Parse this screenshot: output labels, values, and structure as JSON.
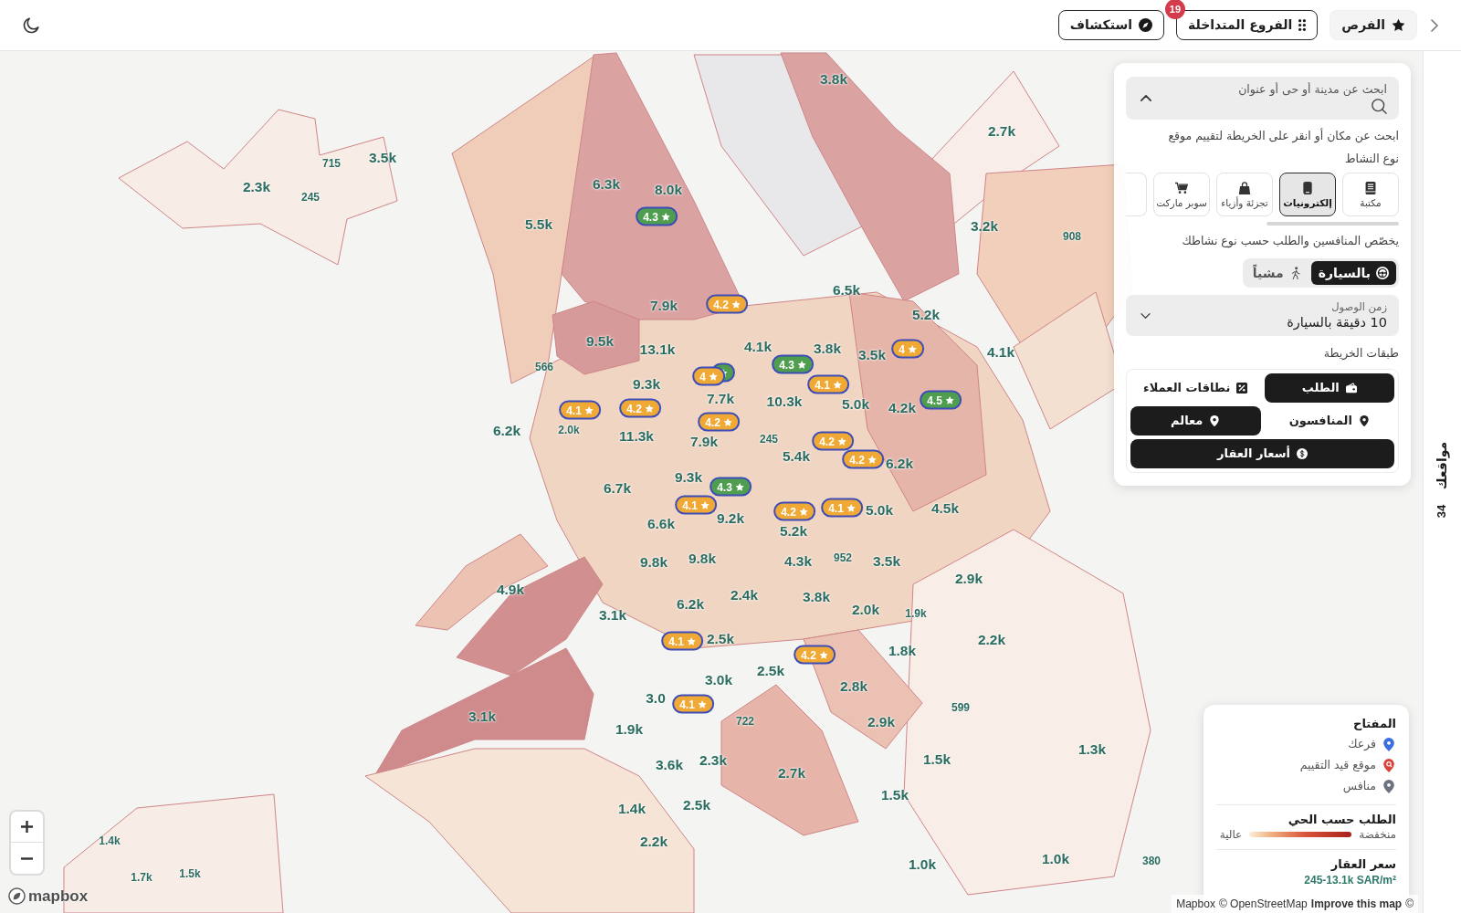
{
  "top_bar": {
    "buttons": [
      {
        "label": "الفرص",
        "kind": "filled"
      },
      {
        "label": "الفروع المتداخلة",
        "kind": "outlined",
        "badge": "19"
      },
      {
        "label": "استكشاف",
        "kind": "outlined"
      }
    ]
  },
  "side_panel": {
    "search": {
      "placeholder": "ابحث عن مدينة أو حى أو عنوان",
      "expanded": true
    },
    "hint": "ابحث عن مكان أو انقر على الخريطة لتقييم موقع",
    "activity_label": "نوع النشاط",
    "activity_types": [
      {
        "label": "مكتبة",
        "selected": false
      },
      {
        "label": "إلكترونيات",
        "selected": true
      },
      {
        "label": "تجزئة وأزياء",
        "selected": false
      },
      {
        "label": "سوبر ماركت",
        "selected": false
      },
      {
        "selected": false
      }
    ],
    "activity_note": "يخصّص المنافسين والطلب حسب نوع نشاطك",
    "travel_modes": [
      {
        "label": "بالسيارة",
        "selected": true
      },
      {
        "label": "مشياً",
        "selected": false
      }
    ],
    "arrival_time": {
      "label": "زمن الوصول",
      "value": "10 دقيقة بالسيارة"
    },
    "layers_label": "طبقات الخريطة",
    "layers": [
      {
        "label": "الطلب",
        "on": true
      },
      {
        "label": "نطاقات العملاء",
        "on": false
      },
      {
        "label": "المنافسون",
        "on": false
      },
      {
        "label": "معالم",
        "on": true
      },
      {
        "label": "أسعار العقار",
        "on": true
      }
    ]
  },
  "side_tab": {
    "label": "مواقعك",
    "count": "34"
  },
  "map": {
    "demand_labels": [
      "3.8k",
      "2.7k",
      "3.5k",
      "715",
      "2.3k",
      "245",
      "6.3k",
      "8.0k",
      "5.5k",
      "3.2k",
      "908",
      "6.5k",
      "5.2k",
      "7.9k",
      "9.5k",
      "13.1k",
      "4.1k",
      "3.8k",
      "3.5k",
      "4.1k",
      "566",
      "9.3k",
      "7.7k",
      "10.3k",
      "5.0k",
      "4.2k",
      "6.2k",
      "2.0k",
      "11.3k",
      "7.9k",
      "245",
      "5.4k",
      "6.2k",
      "9.3k",
      "6.7k",
      "9.2k",
      "6.6k",
      "5.2k",
      "5.0k",
      "4.5k",
      "9.8k",
      "9.8k",
      "4.3k",
      "952",
      "3.5k",
      "2.9k",
      "4.9k",
      "3.1k",
      "6.2k",
      "2.4k",
      "3.8k",
      "2.0k",
      "1.9k",
      "2.5k",
      "2.2k",
      "1.8k",
      "2.5k",
      "3.0k",
      "2.8k",
      "3.0",
      "3.1k",
      "722",
      "1.9k",
      "2.9k",
      "599",
      "3.6k",
      "2.3k",
      "2.7k",
      "1.5k",
      "1.3k",
      "1.5k",
      "1.4k",
      "2.5k",
      "2.2k",
      "1.0k",
      "1.0k",
      "380",
      "1.4k",
      "1.7k",
      "1.5k"
    ],
    "rating_markers": [
      {
        "rating": "4.3",
        "color": "#4f9d4f"
      },
      {
        "rating": "4.2",
        "color": "#f0a935"
      },
      {
        "rating": "4",
        "color": "#f0a935"
      },
      {
        "rating": "4.3",
        "color": "#4f9d4f"
      },
      {
        "color": "#4f9d4f"
      },
      {
        "rating": "4",
        "color": "#f0a935"
      },
      {
        "rating": "4.1",
        "color": "#f0a935"
      },
      {
        "rating": "4.5",
        "color": "#4f9d4f"
      },
      {
        "rating": "4.2",
        "color": "#f0a935"
      },
      {
        "rating": "4.1",
        "color": "#f0a935"
      },
      {
        "rating": "4.2",
        "color": "#f0a935"
      },
      {
        "rating": "4.2",
        "color": "#f0a935"
      },
      {
        "rating": "4.2",
        "color": "#f0a935"
      },
      {
        "rating": "4.3",
        "color": "#4f9d4f"
      },
      {
        "rating": "4.1",
        "color": "#f0a935"
      },
      {
        "rating": "4.1",
        "color": "#f0a935"
      },
      {
        "rating": "4.2",
        "color": "#f0a935"
      },
      {
        "rating": "4.1",
        "color": "#f0a935"
      },
      {
        "rating": "4.2",
        "color": "#f0a935"
      },
      {
        "rating": "4.1",
        "color": "#f0a935"
      }
    ],
    "logo": "mapbox",
    "attribution": [
      {
        "text": "Mapbox",
        "emphasized": false
      },
      {
        "text": "© OpenStreetMap",
        "emphasized": false
      },
      {
        "text": "Improve this map",
        "emphasized": true
      },
      {
        "text": "©",
        "emphasized": false
      }
    ]
  },
  "legend": {
    "title": "المفتاح",
    "items": [
      {
        "label": "فرعك",
        "kind": "branch",
        "color": "#3b6fe0"
      },
      {
        "label": "موقع قيد التقييم",
        "kind": "evaluating",
        "color": "#d9423c"
      },
      {
        "label": "منافس",
        "kind": "competitor",
        "color": "#6b7280"
      }
    ],
    "demand": {
      "title": "الطلب حسب الحي",
      "low": "منخفضة",
      "high": "عالية"
    },
    "price": {
      "title": "سعر العقار",
      "range": "245-13.1k SAR/m²"
    }
  }
}
